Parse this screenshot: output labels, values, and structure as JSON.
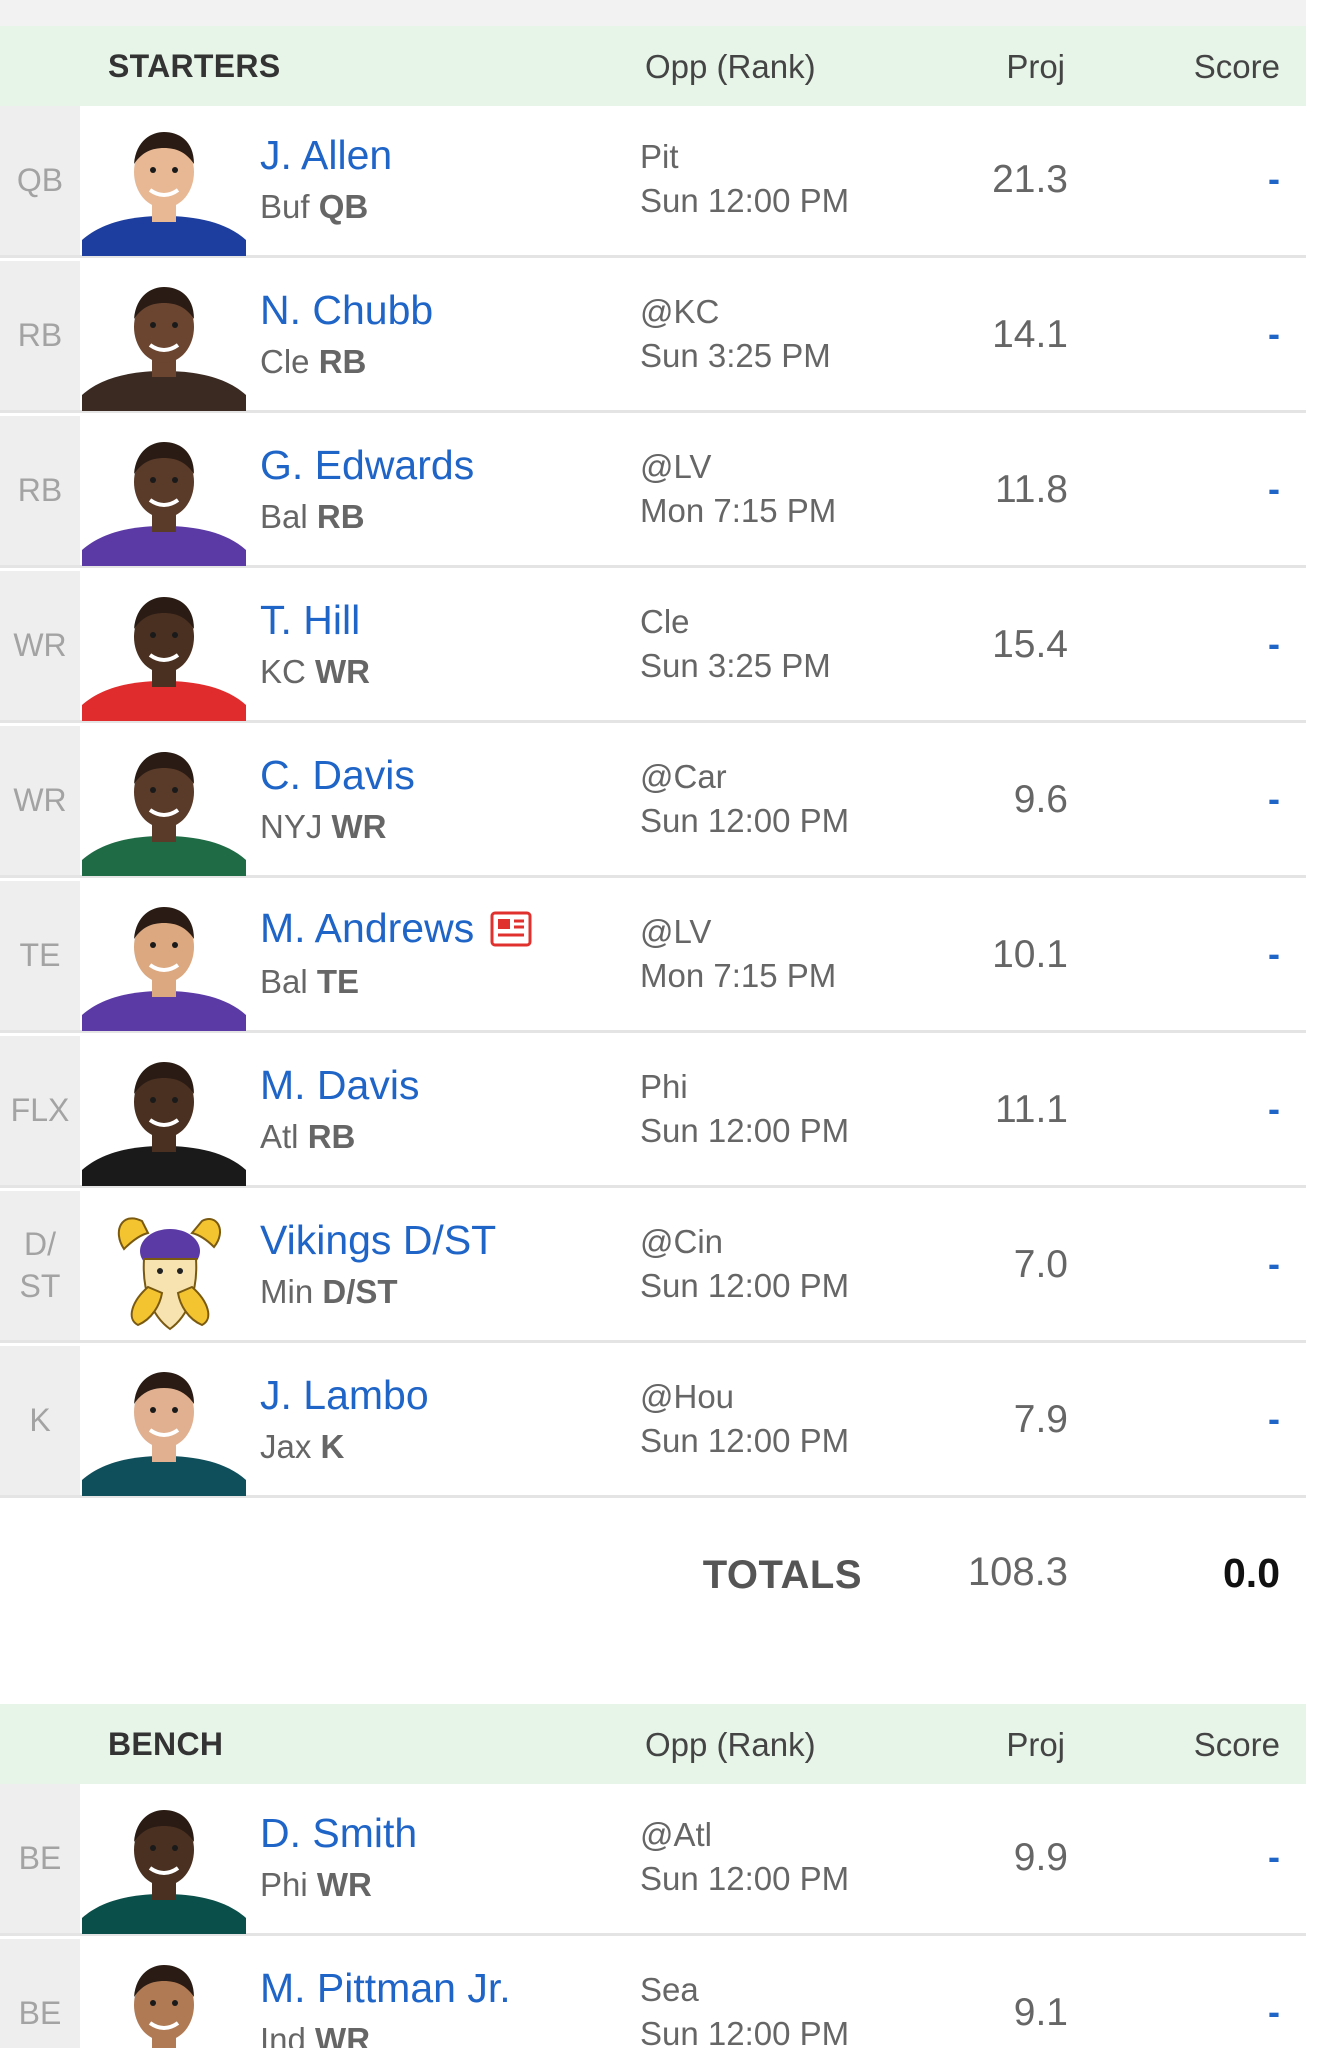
{
  "starters": {
    "header": {
      "title": "STARTERS",
      "opp": "Opp (Rank)",
      "proj": "Proj",
      "score": "Score"
    },
    "players": [
      {
        "slot": "QB",
        "name": "J. Allen",
        "team": "Buf",
        "pos": "QB",
        "opp": "Pit",
        "time": "Sun 12:00 PM",
        "proj": "21.3",
        "score": "-",
        "jersey": "#1d3e9e",
        "skin": "#e8b894"
      },
      {
        "slot": "RB",
        "name": "N. Chubb",
        "team": "Cle",
        "pos": "RB",
        "opp": "@KC",
        "time": "Sun 3:25 PM",
        "proj": "14.1",
        "score": "-",
        "jersey": "#3a2a22",
        "skin": "#6b4530"
      },
      {
        "slot": "RB",
        "name": "G. Edwards",
        "team": "Bal",
        "pos": "RB",
        "opp": "@LV",
        "time": "Mon 7:15 PM",
        "proj": "11.8",
        "score": "-",
        "jersey": "#5b3aa6",
        "skin": "#5a3a28"
      },
      {
        "slot": "WR",
        "name": "T. Hill",
        "team": "KC",
        "pos": "WR",
        "opp": "Cle",
        "time": "Sun 3:25 PM",
        "proj": "15.4",
        "score": "-",
        "jersey": "#e02c2c",
        "skin": "#4a3020"
      },
      {
        "slot": "WR",
        "name": "C. Davis",
        "team": "NYJ",
        "pos": "WR",
        "opp": "@Car",
        "time": "Sun 12:00 PM",
        "proj": "9.6",
        "score": "-",
        "jersey": "#1f6b45",
        "skin": "#5a3a28"
      },
      {
        "slot": "TE",
        "name": "M. Andrews",
        "team": "Bal",
        "pos": "TE",
        "opp": "@LV",
        "time": "Mon 7:15 PM",
        "proj": "10.1",
        "score": "-",
        "jersey": "#5b3aa6",
        "skin": "#dba880",
        "news": true
      },
      {
        "slot": "FLX",
        "name": "M. Davis",
        "team": "Atl",
        "pos": "RB",
        "opp": "Phi",
        "time": "Sun 12:00 PM",
        "proj": "11.1",
        "score": "-",
        "jersey": "#1a1a1a",
        "skin": "#4a3020"
      },
      {
        "slot": "D/ ST",
        "name": "Vikings D/ST",
        "team": "Min",
        "pos": "D/ST",
        "opp": "@Cin",
        "time": "Sun 12:00 PM",
        "proj": "7.0",
        "score": "-",
        "logo": true
      },
      {
        "slot": "K",
        "name": "J. Lambo",
        "team": "Jax",
        "pos": "K",
        "opp": "@Hou",
        "time": "Sun 12:00 PM",
        "proj": "7.9",
        "score": "-",
        "jersey": "#0f4f5c",
        "skin": "#e0b090"
      }
    ],
    "totals": {
      "label": "TOTALS",
      "proj": "108.3",
      "score": "0.0"
    }
  },
  "bench": {
    "header": {
      "title": "BENCH",
      "opp": "Opp (Rank)",
      "proj": "Proj",
      "score": "Score"
    },
    "players": [
      {
        "slot": "BE",
        "name": "D. Smith",
        "team": "Phi",
        "pos": "WR",
        "opp": "@Atl",
        "time": "Sun 12:00 PM",
        "proj": "9.9",
        "score": "-",
        "jersey": "#0a4f4a",
        "skin": "#4a3020"
      },
      {
        "slot": "BE",
        "name": "M. Pittman Jr.",
        "team": "Ind",
        "pos": "WR",
        "opp": "Sea",
        "time": "Sun 12:00 PM",
        "proj": "9.1",
        "score": "-",
        "jersey": "#1a3a8a",
        "skin": "#b07a55"
      }
    ]
  }
}
